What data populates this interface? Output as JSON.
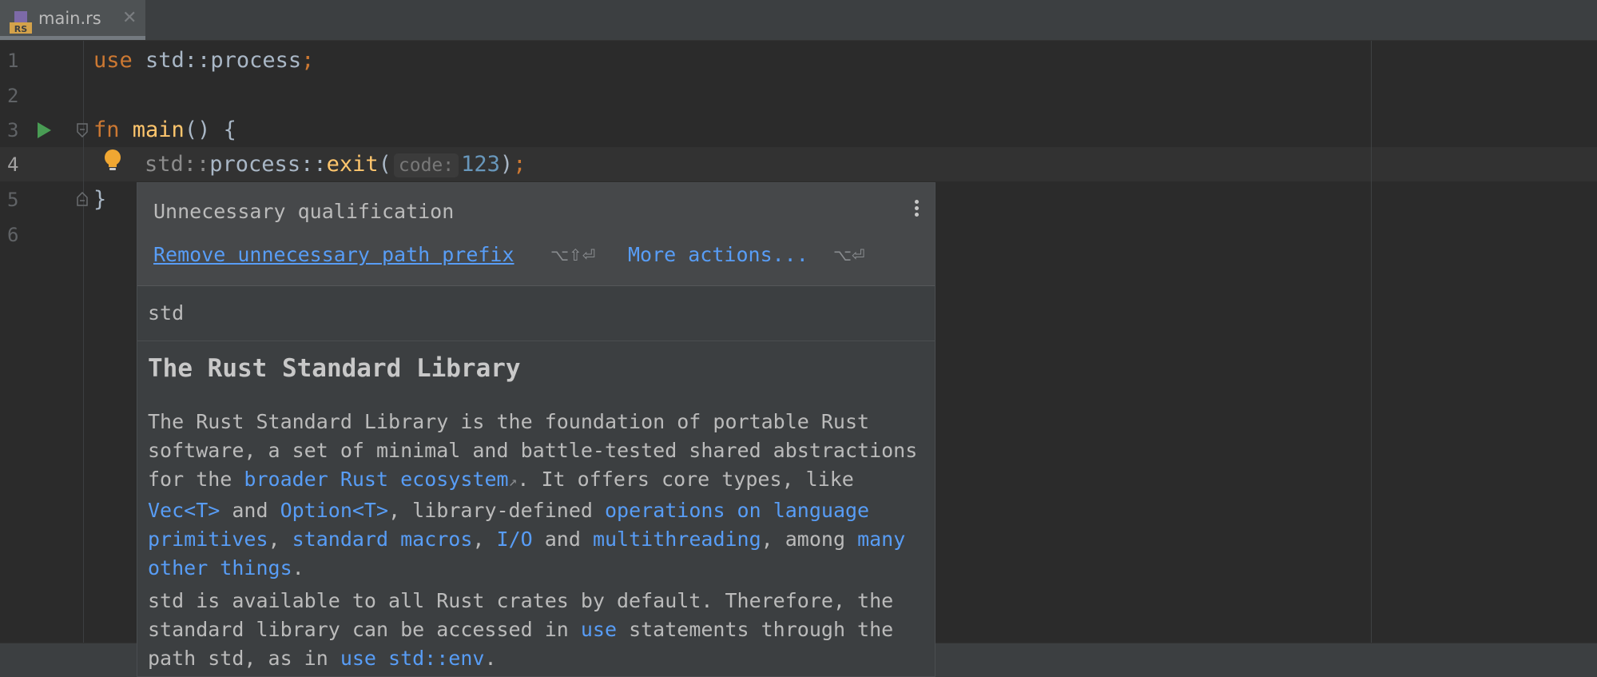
{
  "tab": {
    "file_name": "main.rs",
    "icon_badge": "RS",
    "close_glyph": "✕"
  },
  "editor": {
    "line_numbers": [
      "1",
      "2",
      "3",
      "4",
      "5",
      "6"
    ],
    "line1": {
      "kw": "use",
      "rest": " std::process",
      "semi": ";"
    },
    "line3": {
      "kw": "fn",
      "name": "main",
      "rest": "() {"
    },
    "line4": {
      "path_prefix": "std::",
      "path_mid": "process::",
      "call": "exit",
      "open": "(",
      "param_hint": "code:",
      "arg": "123",
      "close": ")",
      "semi": ";"
    },
    "line5": {
      "text": "}"
    }
  },
  "popup": {
    "title": "Unnecessary qualification",
    "primary_action": "Remove unnecessary path prefix",
    "primary_shortcut": "⌥⇧⏎",
    "secondary_action": "More actions...",
    "secondary_shortcut": "⌥⏎",
    "definition": "std",
    "heading": "The Rust Standard Library",
    "p1": {
      "t1": "The Rust Standard Library is the foundation of portable Rust software, a set of minimal and battle-tested shared abstractions for the ",
      "link1": "broader Rust ecosystem",
      "ext": "↗",
      "t2": ". It offers core types, like ",
      "link2": "Vec<T>",
      "t3": " and ",
      "link3": "Option<T>",
      "t4": ", library-defined ",
      "link4": "operations on language primitives",
      "t5": ", ",
      "link5": "standard macros",
      "t6": ", ",
      "link6": "I/O",
      "t7": " and ",
      "link7": "multithreading",
      "t8": ", among ",
      "link8": "many other things",
      "t9": "."
    },
    "p2": {
      "t1": "std is available to all Rust crates by default. Therefore, the standard library can be accessed in ",
      "link1": "use",
      "t2": " statements through the path std, as in ",
      "link2": "use std::env",
      "t3": "."
    }
  },
  "colors": {
    "background": "#2b2b2b",
    "keyword": "#cc7832",
    "function": "#ffc66d",
    "number": "#6897bb",
    "link": "#589df6",
    "run_icon": "#499c54",
    "bulb": "#f0a732"
  }
}
